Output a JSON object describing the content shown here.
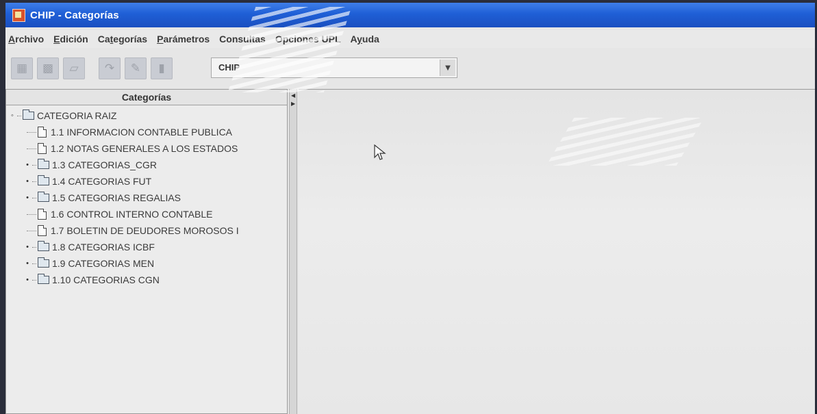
{
  "window": {
    "title": "CHIP - Categorías"
  },
  "menubar": {
    "items": [
      {
        "mnemonic": "A",
        "rest": "rchivo"
      },
      {
        "mnemonic": "E",
        "rest": "dición"
      },
      {
        "pre": "Ca",
        "mnemonic": "t",
        "rest": "egorías"
      },
      {
        "mnemonic": "P",
        "rest": "arámetros"
      },
      {
        "mnemonic": "",
        "rest": "Consultas"
      },
      {
        "mnemonic": "",
        "rest": "Opciones UPL"
      },
      {
        "pre": "A",
        "mnemonic": "y",
        "rest": "uda"
      }
    ]
  },
  "toolbar": {
    "buttons": [
      "new-icon",
      "save-icon",
      "print-icon",
      "undo-icon",
      "edit-icon",
      "delete-icon"
    ],
    "combo_value": "CHIP"
  },
  "left_panel": {
    "header": "Categorías",
    "tree": [
      {
        "label": "CATEGORIA RAIZ",
        "type": "folder",
        "level": 0,
        "expanded": true
      },
      {
        "label": "1.1 INFORMACION CONTABLE PUBLICA",
        "type": "doc",
        "level": 1
      },
      {
        "label": "1.2 NOTAS GENERALES A LOS ESTADOS",
        "type": "doc",
        "level": 1
      },
      {
        "label": "1.3 CATEGORIAS_CGR",
        "type": "folder",
        "level": 1
      },
      {
        "label": "1.4 CATEGORIAS FUT",
        "type": "folder",
        "level": 1
      },
      {
        "label": "1.5 CATEGORIAS REGALIAS",
        "type": "folder",
        "level": 1
      },
      {
        "label": "1.6 CONTROL INTERNO CONTABLE",
        "type": "doc",
        "level": 1
      },
      {
        "label": "1.7 BOLETIN DE DEUDORES MOROSOS I",
        "type": "doc",
        "level": 1
      },
      {
        "label": "1.8 CATEGORIAS ICBF",
        "type": "folder",
        "level": 1
      },
      {
        "label": "1.9 CATEGORIAS MEN",
        "type": "folder",
        "level": 1
      },
      {
        "label": "1.10 CATEGORIAS CGN",
        "type": "folder",
        "level": 1
      }
    ]
  },
  "colors": {
    "titlebar": "#1f5fd6",
    "window_bg": "#e6e6e6"
  }
}
